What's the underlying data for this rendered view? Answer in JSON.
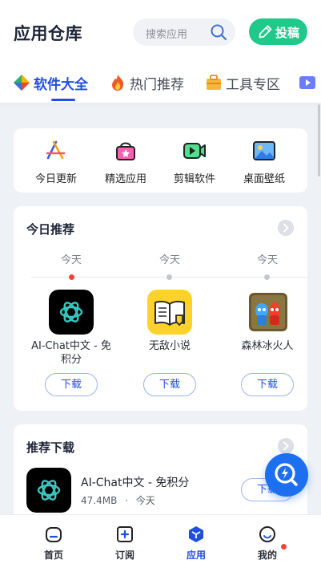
{
  "header": {
    "title": "应用仓库",
    "search_placeholder": "搜索应用",
    "post_label": "投稿"
  },
  "tabs": [
    {
      "label": "软件大全",
      "icon": "diamond-icon",
      "active": true
    },
    {
      "label": "热门推荐",
      "icon": "flame-icon",
      "active": false
    },
    {
      "label": "工具专区",
      "icon": "toolbox-icon",
      "active": false
    },
    {
      "label": "",
      "icon": "video-icon",
      "active": false
    }
  ],
  "quick_links": [
    {
      "label": "今日更新",
      "icon": "app-store-icon"
    },
    {
      "label": "精选应用",
      "icon": "shopping-bag-icon"
    },
    {
      "label": "剪辑软件",
      "icon": "video-camera-icon"
    },
    {
      "label": "桌面壁纸",
      "icon": "picture-icon"
    }
  ],
  "today_recommend": {
    "title": "今日推荐",
    "items": [
      {
        "day": "今天",
        "name": "AI-Chat中文 - 免积分",
        "download": "下载",
        "current": true
      },
      {
        "day": "今天",
        "name": "无敌小说",
        "download": "下载",
        "current": false
      },
      {
        "day": "今天",
        "name": "森林冰火人",
        "download": "下载",
        "current": false
      }
    ]
  },
  "recommend_download": {
    "title": "推荐下载",
    "items": [
      {
        "name": "AI-Chat中文 - 免积分",
        "size": "47.4MB",
        "separator": "·",
        "date": "今天",
        "download": "下载"
      }
    ]
  },
  "bottom_nav": [
    {
      "label": "首页",
      "icon": "home-icon",
      "active": false
    },
    {
      "label": "订阅",
      "icon": "subscribe-icon",
      "active": false
    },
    {
      "label": "应用",
      "icon": "apps-icon",
      "active": true
    },
    {
      "label": "我的",
      "icon": "profile-icon",
      "active": false
    }
  ],
  "colors": {
    "accent": "#1f4fe0",
    "post_button": "#1fc98a",
    "fab": "#1d6ff2",
    "badge": "#f0453a"
  }
}
